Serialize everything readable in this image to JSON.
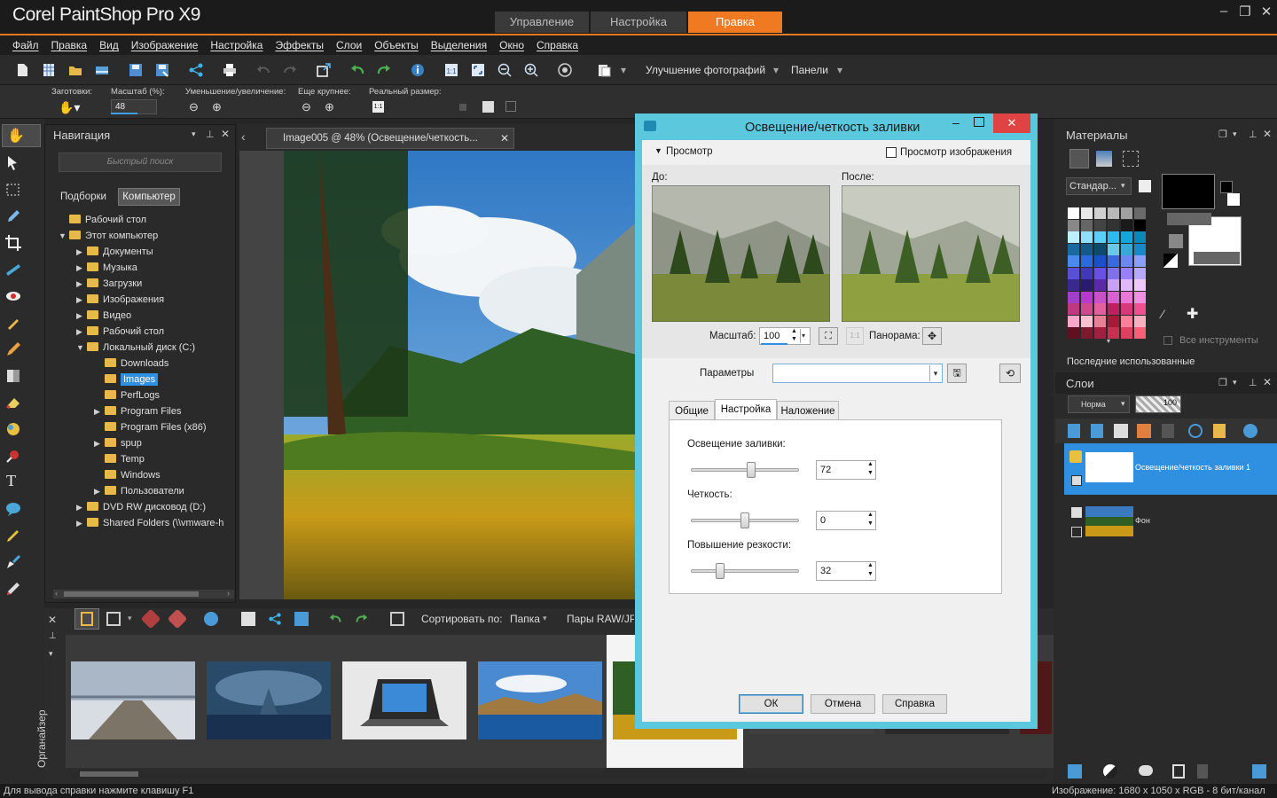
{
  "app": {
    "title": "Corel PaintShop Pro X9"
  },
  "workspace_tabs": [
    "Управление",
    "Настройка",
    "Правка"
  ],
  "menu": [
    "Файл",
    "Правка",
    "Вид",
    "Изображение",
    "Настройка",
    "Эффекты",
    "Слои",
    "Объекты",
    "Выделения",
    "Окно",
    "Справка"
  ],
  "toolbar": {
    "enhance_label": "Улучшение фотографий",
    "panels_label": "Панели"
  },
  "options": {
    "presets": "Заготовки:",
    "zoom_pct": "Масштаб (%):",
    "zoom_value": "48",
    "zoom_in_out": "Уменьшение/увеличение:",
    "more": "Еще крупнее:",
    "actual": "Реальный размер:"
  },
  "nav": {
    "title": "Навигация",
    "search_placeholder": "Быстрый поиск",
    "tab_collections": "Подборки",
    "tab_computer": "Компьютер",
    "tree": [
      {
        "label": "Рабочий стол",
        "indent": 0,
        "twisty": ""
      },
      {
        "label": "Этот компьютер",
        "indent": 0,
        "twisty": "▼"
      },
      {
        "label": "Документы",
        "indent": 1,
        "twisty": "▶"
      },
      {
        "label": "Музыка",
        "indent": 1,
        "twisty": "▶"
      },
      {
        "label": "Загрузки",
        "indent": 1,
        "twisty": "▶"
      },
      {
        "label": "Изображения",
        "indent": 1,
        "twisty": "▶"
      },
      {
        "label": "Видео",
        "indent": 1,
        "twisty": "▶"
      },
      {
        "label": "Рабочий стол",
        "indent": 1,
        "twisty": "▶"
      },
      {
        "label": "Локальный диск (C:)",
        "indent": 1,
        "twisty": "▼"
      },
      {
        "label": "Downloads",
        "indent": 2,
        "twisty": ""
      },
      {
        "label": "Images",
        "indent": 2,
        "twisty": "",
        "selected": true
      },
      {
        "label": "PerfLogs",
        "indent": 2,
        "twisty": ""
      },
      {
        "label": "Program Files",
        "indent": 2,
        "twisty": "▶"
      },
      {
        "label": "Program Files (x86)",
        "indent": 2,
        "twisty": ""
      },
      {
        "label": "spup",
        "indent": 2,
        "twisty": "▶"
      },
      {
        "label": "Temp",
        "indent": 2,
        "twisty": ""
      },
      {
        "label": "Windows",
        "indent": 2,
        "twisty": ""
      },
      {
        "label": "Пользователи",
        "indent": 2,
        "twisty": "▶"
      },
      {
        "label": "DVD RW дисковод (D:)",
        "indent": 1,
        "twisty": "▶"
      },
      {
        "label": "Shared Folders (\\\\vmware-h",
        "indent": 1,
        "twisty": "▶"
      }
    ]
  },
  "doc_tab": {
    "title": "Image005 @   48% (Освещение/четкость..."
  },
  "organizer": {
    "label": "Органайзер",
    "sort_by": "Сортировать по:",
    "sort_value": "Папка",
    "raw_pairs": "Пары RAW/JPG"
  },
  "dialog": {
    "title": "Освещение/четкость заливки",
    "preview": "Просмотр",
    "image_preview": "Просмотр изображения",
    "before": "До:",
    "after": "После:",
    "zoom_label": "Масштаб:",
    "zoom_value": "100",
    "pan_label": "Панорама:",
    "params_label": "Параметры",
    "tabs": [
      "Общие",
      "Настройка",
      "Наложение"
    ],
    "fill_light_label": "Освещение заливки:",
    "fill_light_value": "72",
    "clarity_label": "Четкость:",
    "clarity_value": "0",
    "sharpen_label": "Повышение резкости:",
    "sharpen_value": "32",
    "ok": "ОК",
    "cancel": "Отмена",
    "help": "Справка"
  },
  "materials": {
    "title": "Материалы",
    "preset": "Стандар...",
    "all_tools": "Все инструменты",
    "recent": "Последние использованные"
  },
  "layers": {
    "title": "Слои",
    "blend": "Норма",
    "opacity": "100",
    "items": [
      "Освещение/четкость заливки 1",
      "Фон"
    ]
  },
  "status": {
    "left": "Для вывода справки нажмите клавишу F1",
    "right": "Изображение:  1680 x 1050 x RGB - 8 бит/канал"
  },
  "colors": {
    "accent": "#ef7a22",
    "dialog_frame": "#5bc8de",
    "selection": "#2f8fe0"
  }
}
